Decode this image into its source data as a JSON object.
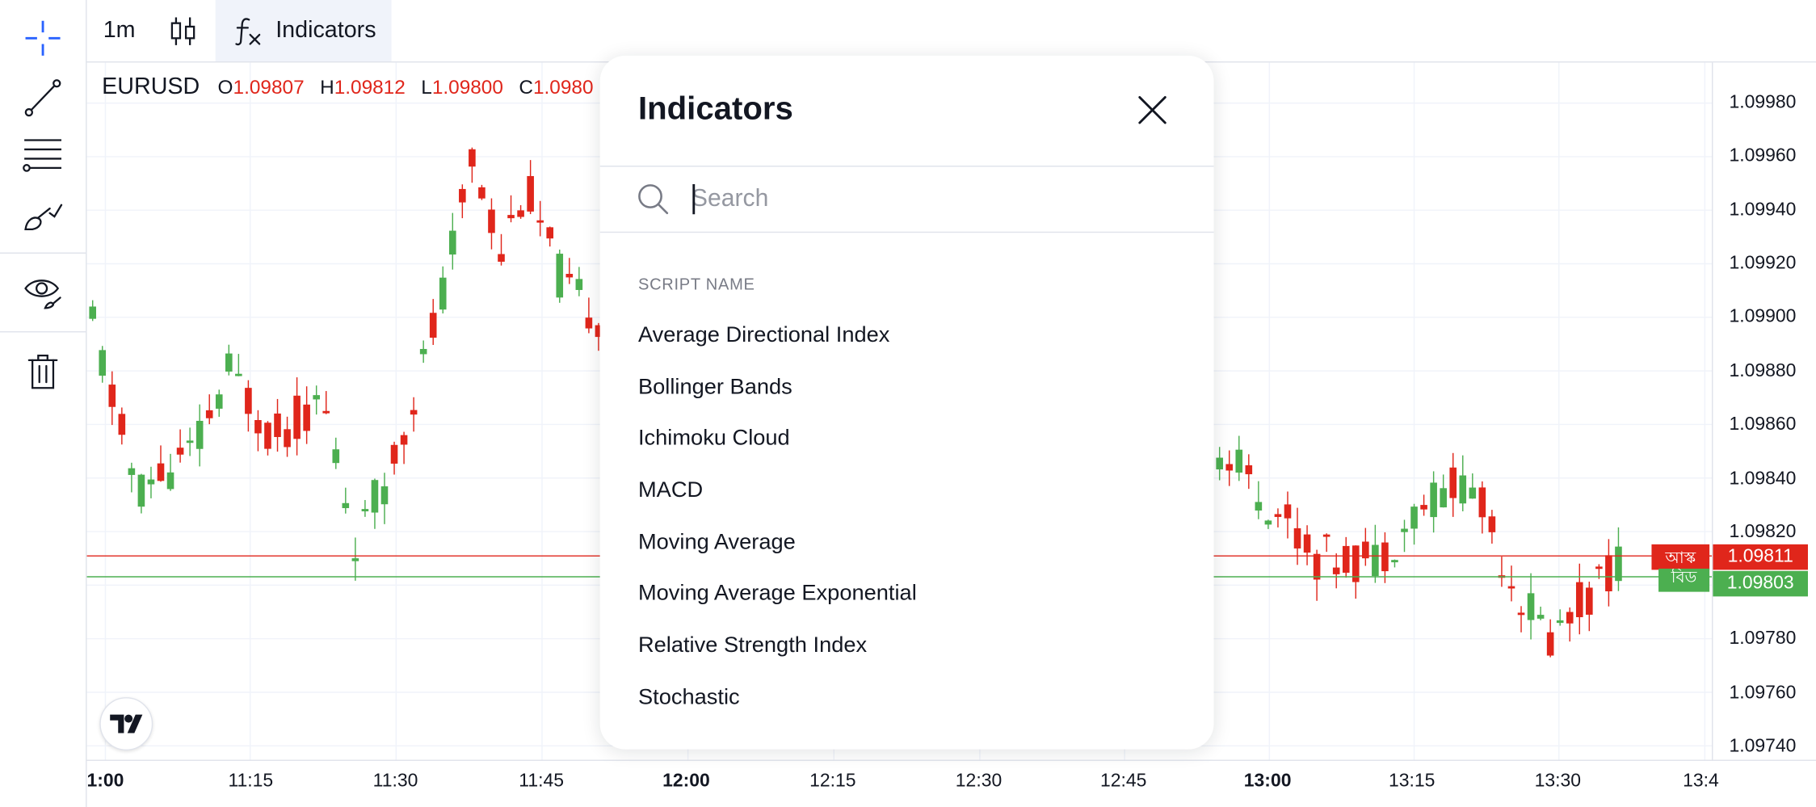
{
  "toolbar": {
    "timeframe": "1m",
    "indicators_label": "Indicators"
  },
  "left_tools": [
    {
      "icon": "crosshair-icon"
    },
    {
      "icon": "trend-line-icon"
    },
    {
      "icon": "horizontal-lines-icon"
    },
    {
      "icon": "brush-icon"
    },
    {
      "icon": "eye-icon"
    },
    {
      "icon": "trash-icon"
    }
  ],
  "legend": {
    "symbol": "EURUSD",
    "o_label": "O",
    "o_value": "1.09807",
    "h_label": "H",
    "h_value": "1.09812",
    "l_label": "L",
    "l_value": "1.09800",
    "c_label": "C",
    "c_value": "1.0980"
  },
  "price_axis": [
    "1.09980",
    "1.09960",
    "1.09940",
    "1.09920",
    "1.09900",
    "1.09880",
    "1.09860",
    "1.09840",
    "1.09820",
    "1.09780",
    "1.09760",
    "1.09740"
  ],
  "time_axis": [
    {
      "label": "1:00",
      "bold": true
    },
    {
      "label": "11:15",
      "bold": false
    },
    {
      "label": "11:30",
      "bold": false
    },
    {
      "label": "11:45",
      "bold": false
    },
    {
      "label": "12:00",
      "bold": true
    },
    {
      "label": "12:15",
      "bold": false
    },
    {
      "label": "12:30",
      "bold": false
    },
    {
      "label": "12:45",
      "bold": false
    },
    {
      "label": "13:00",
      "bold": true
    },
    {
      "label": "13:15",
      "bold": false
    },
    {
      "label": "13:30",
      "bold": false
    },
    {
      "label": "13:4",
      "bold": false
    }
  ],
  "price_tags": {
    "ask_label": "আস্ক",
    "ask_value": "1.09811",
    "bid_label": "বিড",
    "bid_value": "1.09803"
  },
  "colors": {
    "up": "#4caf50",
    "down": "#e0261b",
    "accent": "#2962ff"
  },
  "modal": {
    "title": "Indicators",
    "search_placeholder": "Search",
    "section_header": "SCRIPT NAME",
    "items": [
      "Average Directional Index",
      "Bollinger Bands",
      "Ichimoku Cloud",
      "MACD",
      "Moving Average",
      "Moving Average Exponential",
      "Relative Strength Index",
      "Stochastic"
    ]
  }
}
